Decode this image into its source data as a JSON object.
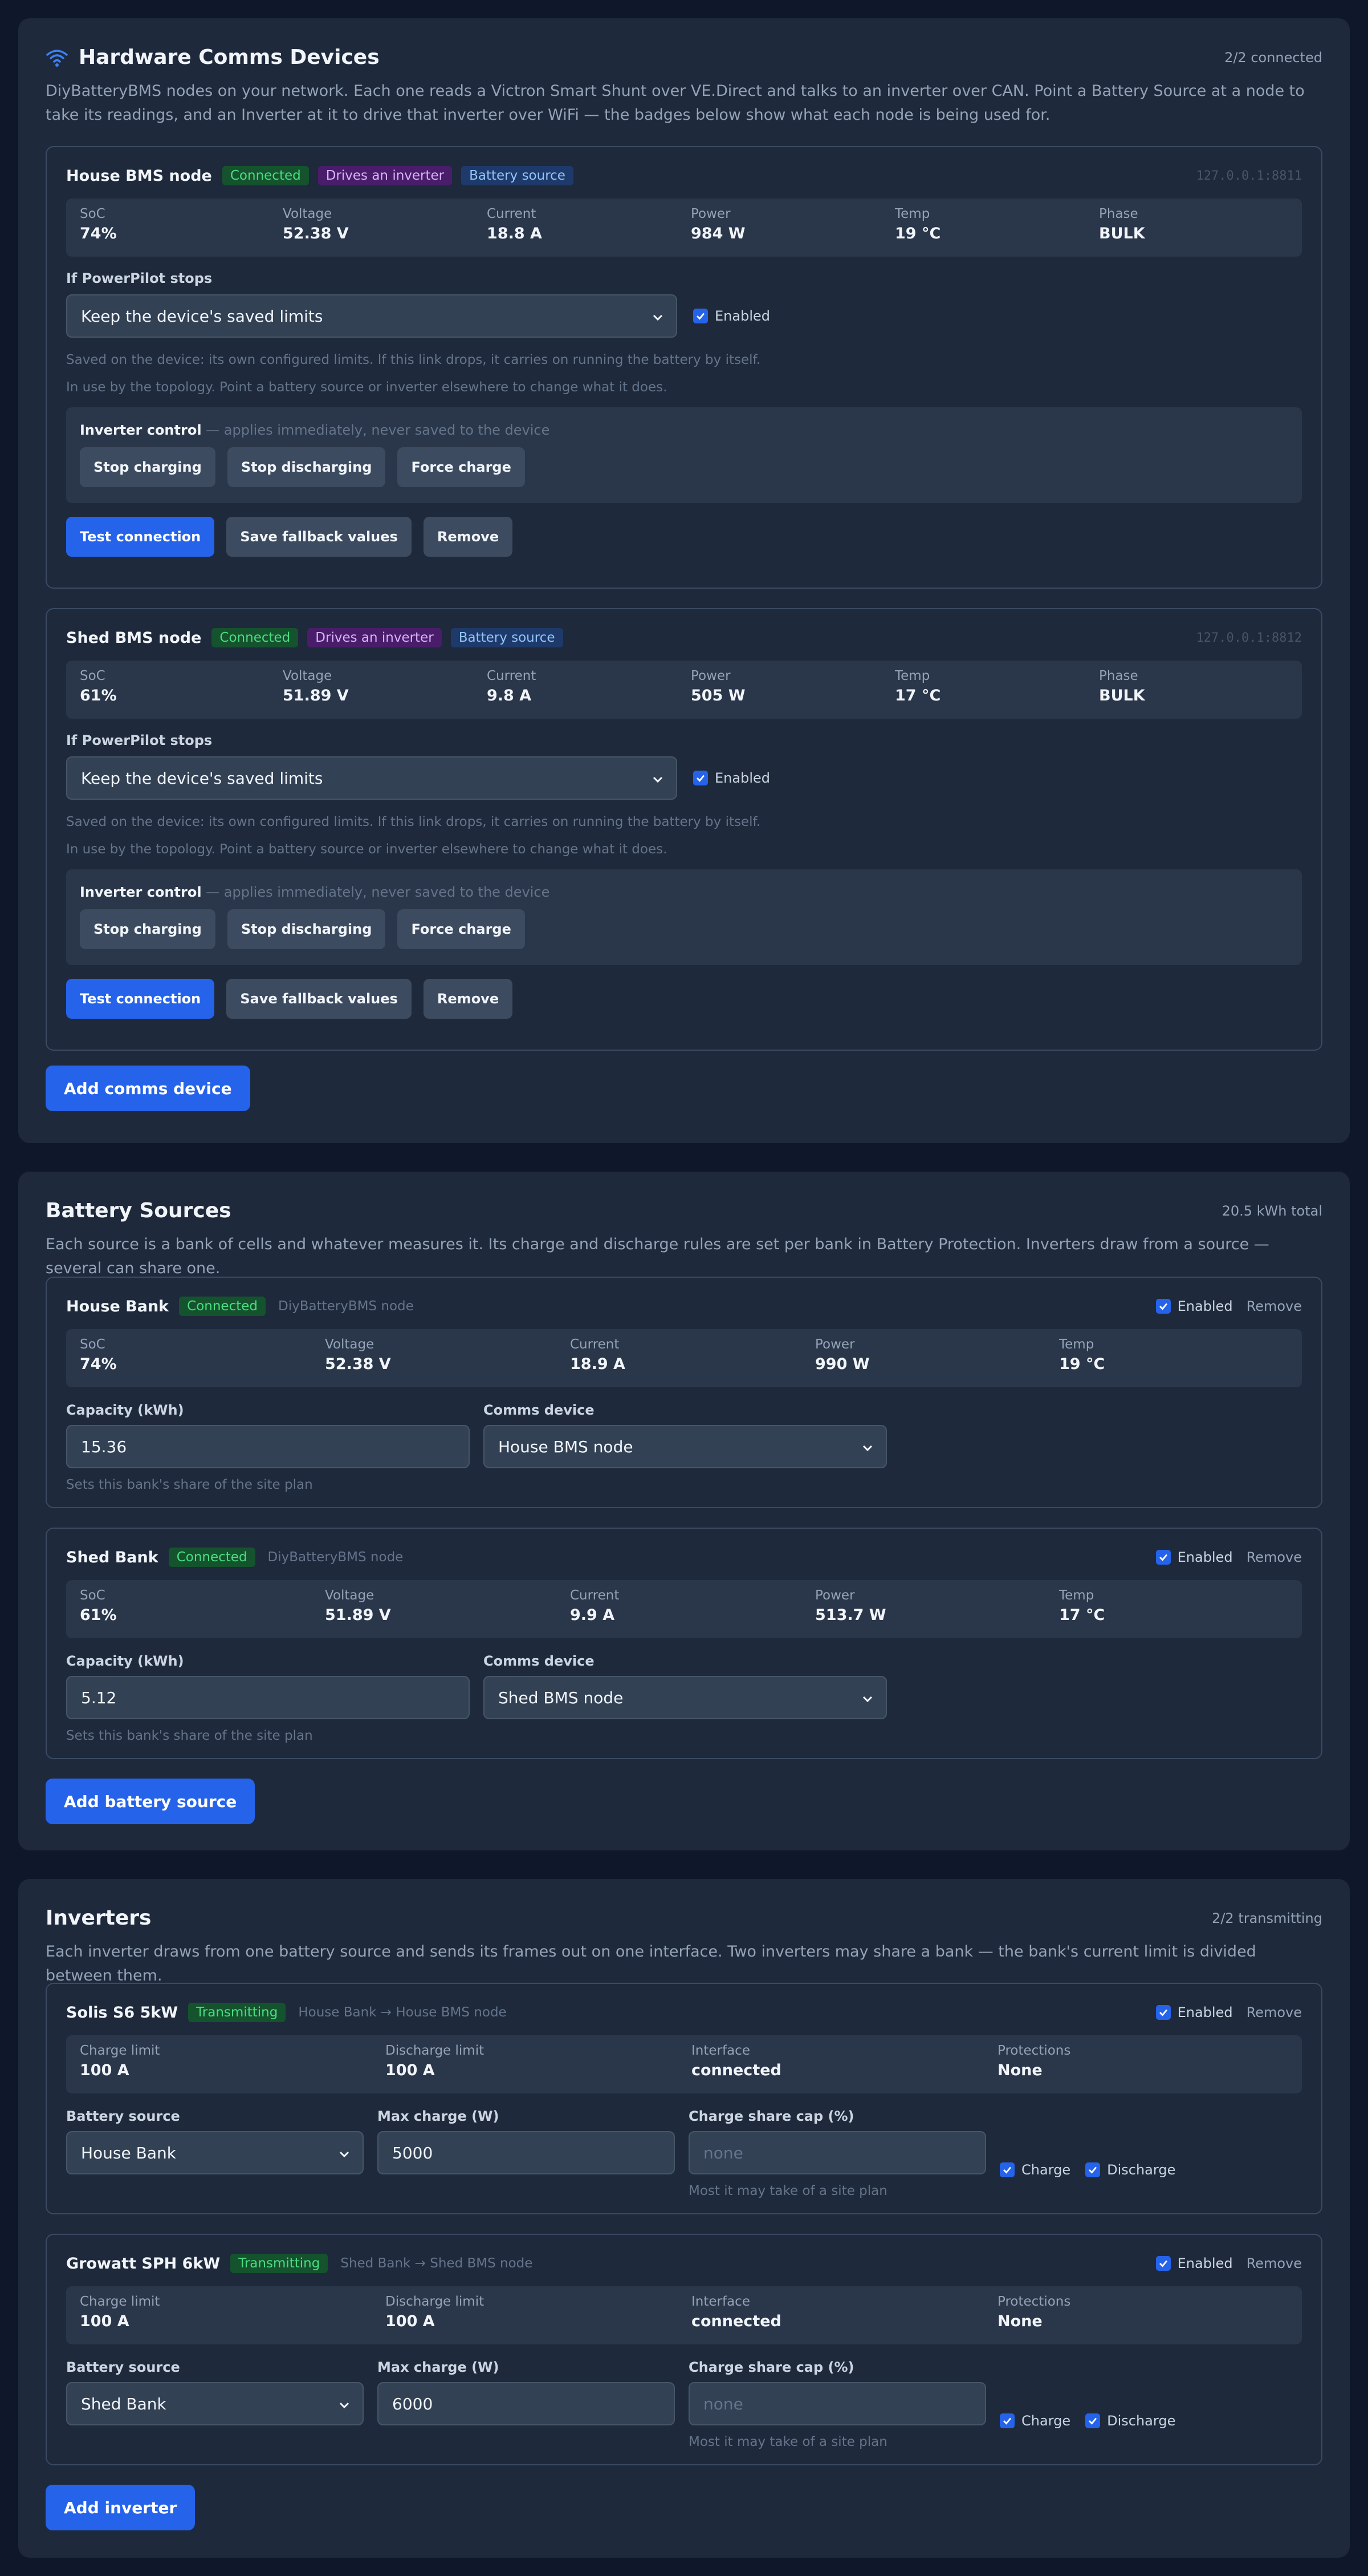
{
  "comms": {
    "title": "Hardware Comms Devices",
    "meta": "2/2 connected",
    "description": "DiyBatteryBMS nodes on your network. Each one reads a Victron Smart Shunt over VE.Direct and talks to an inverter over CAN. Point a Battery Source at a node to take its readings, and an Inverter at it to drive that inverter over WiFi — the badges below show what each node is being used for.",
    "devices": [
      {
        "name": "House BMS node",
        "badges": [
          "Connected",
          "Drives an inverter",
          "Battery source"
        ],
        "address": "127.0.0.1:8811",
        "stats": [
          {
            "label": "SoC",
            "value": "74%"
          },
          {
            "label": "Voltage",
            "value": "52.38 V"
          },
          {
            "label": "Current",
            "value": "18.8 A"
          },
          {
            "label": "Power",
            "value": "984 W"
          },
          {
            "label": "Temp",
            "value": "19 °C"
          },
          {
            "label": "Phase",
            "value": "BULK"
          }
        ],
        "fallback_label": "If PowerPilot stops",
        "fallback_value": "Keep the device's saved limits",
        "enabled_label": "Enabled",
        "note1": "Saved on the device: its own configured limits. If this link drops, it carries on running the battery by itself.",
        "note2": "In use by the topology. Point a battery source or inverter elsewhere to change what it does.",
        "control_title": "Inverter control",
        "control_sub": " — applies immediately, never saved to the device",
        "control_buttons": [
          "Stop charging",
          "Stop discharging",
          "Force charge"
        ],
        "actions": [
          "Test connection",
          "Save fallback values",
          "Remove"
        ]
      },
      {
        "name": "Shed BMS node",
        "badges": [
          "Connected",
          "Drives an inverter",
          "Battery source"
        ],
        "address": "127.0.0.1:8812",
        "stats": [
          {
            "label": "SoC",
            "value": "61%"
          },
          {
            "label": "Voltage",
            "value": "51.89 V"
          },
          {
            "label": "Current",
            "value": "9.8 A"
          },
          {
            "label": "Power",
            "value": "505 W"
          },
          {
            "label": "Temp",
            "value": "17 °C"
          },
          {
            "label": "Phase",
            "value": "BULK"
          }
        ],
        "fallback_label": "If PowerPilot stops",
        "fallback_value": "Keep the device's saved limits",
        "enabled_label": "Enabled",
        "note1": "Saved on the device: its own configured limits. If this link drops, it carries on running the battery by itself.",
        "note2": "In use by the topology. Point a battery source or inverter elsewhere to change what it does.",
        "control_title": "Inverter control",
        "control_sub": " — applies immediately, never saved to the device",
        "control_buttons": [
          "Stop charging",
          "Stop discharging",
          "Force charge"
        ],
        "actions": [
          "Test connection",
          "Save fallback values",
          "Remove"
        ]
      }
    ],
    "add_label": "Add comms device"
  },
  "batteries": {
    "title": "Battery Sources",
    "meta": "20.5 kWh total",
    "description": "Each source is a bank of cells and whatever measures it. Its charge and discharge rules are set per bank in Battery Protection. Inverters draw from a source — several can share one.",
    "sources": [
      {
        "name": "House Bank",
        "badge": "Connected",
        "sub": "DiyBatteryBMS node",
        "enabled_label": "Enabled",
        "remove_label": "Remove",
        "stats": [
          {
            "label": "SoC",
            "value": "74%"
          },
          {
            "label": "Voltage",
            "value": "52.38 V"
          },
          {
            "label": "Current",
            "value": "18.9 A"
          },
          {
            "label": "Power",
            "value": "990 W"
          },
          {
            "label": "Temp",
            "value": "19 °C"
          }
        ],
        "capacity_label": "Capacity (kWh)",
        "capacity_value": "15.36",
        "comms_label": "Comms device",
        "comms_value": "House BMS node",
        "hint": "Sets this bank's share of the site plan"
      },
      {
        "name": "Shed Bank",
        "badge": "Connected",
        "sub": "DiyBatteryBMS node",
        "enabled_label": "Enabled",
        "remove_label": "Remove",
        "stats": [
          {
            "label": "SoC",
            "value": "61%"
          },
          {
            "label": "Voltage",
            "value": "51.89 V"
          },
          {
            "label": "Current",
            "value": "9.9 A"
          },
          {
            "label": "Power",
            "value": "513.7 W"
          },
          {
            "label": "Temp",
            "value": "17 °C"
          }
        ],
        "capacity_label": "Capacity (kWh)",
        "capacity_value": "5.12",
        "comms_label": "Comms device",
        "comms_value": "Shed BMS node",
        "hint": "Sets this bank's share of the site plan"
      }
    ],
    "add_label": "Add battery source"
  },
  "inverters": {
    "title": "Inverters",
    "meta": "2/2 transmitting",
    "description": "Each inverter draws from one battery source and sends its frames out on one interface. Two inverters may share a bank — the bank's current limit is divided between them.",
    "items": [
      {
        "name": "Solis S6 5kW",
        "badge": "Transmitting",
        "sub": "House Bank → House BMS node",
        "enabled_label": "Enabled",
        "remove_label": "Remove",
        "stats": [
          {
            "label": "Charge limit",
            "value": "100 A"
          },
          {
            "label": "Discharge limit",
            "value": "100 A"
          },
          {
            "label": "Interface",
            "value": "connected"
          },
          {
            "label": "Protections",
            "value": "None"
          }
        ],
        "source_label": "Battery source",
        "source_value": "House Bank",
        "maxcharge_label": "Max charge (W)",
        "maxcharge_value": "5000",
        "cap_label": "Charge share cap (%)",
        "cap_placeholder": "none",
        "cap_hint": "Most it may take of a site plan",
        "charge_label": "Charge",
        "discharge_label": "Discharge"
      },
      {
        "name": "Growatt SPH 6kW",
        "badge": "Transmitting",
        "sub": "Shed Bank → Shed BMS node",
        "enabled_label": "Enabled",
        "remove_label": "Remove",
        "stats": [
          {
            "label": "Charge limit",
            "value": "100 A"
          },
          {
            "label": "Discharge limit",
            "value": "100 A"
          },
          {
            "label": "Interface",
            "value": "connected"
          },
          {
            "label": "Protections",
            "value": "None"
          }
        ],
        "source_label": "Battery source",
        "source_value": "Shed Bank",
        "maxcharge_label": "Max charge (W)",
        "maxcharge_value": "6000",
        "cap_label": "Charge share cap (%)",
        "cap_placeholder": "none",
        "cap_hint": "Most it may take of a site plan",
        "charge_label": "Charge",
        "discharge_label": "Discharge"
      }
    ],
    "add_label": "Add inverter"
  },
  "colors": {
    "accent": "#2563eb",
    "panel": "#1e293b",
    "background": "#0f172a"
  },
  "icons": {
    "wifi": "wifi-icon",
    "check": "check-icon",
    "chevron": "chevron-down-icon"
  }
}
